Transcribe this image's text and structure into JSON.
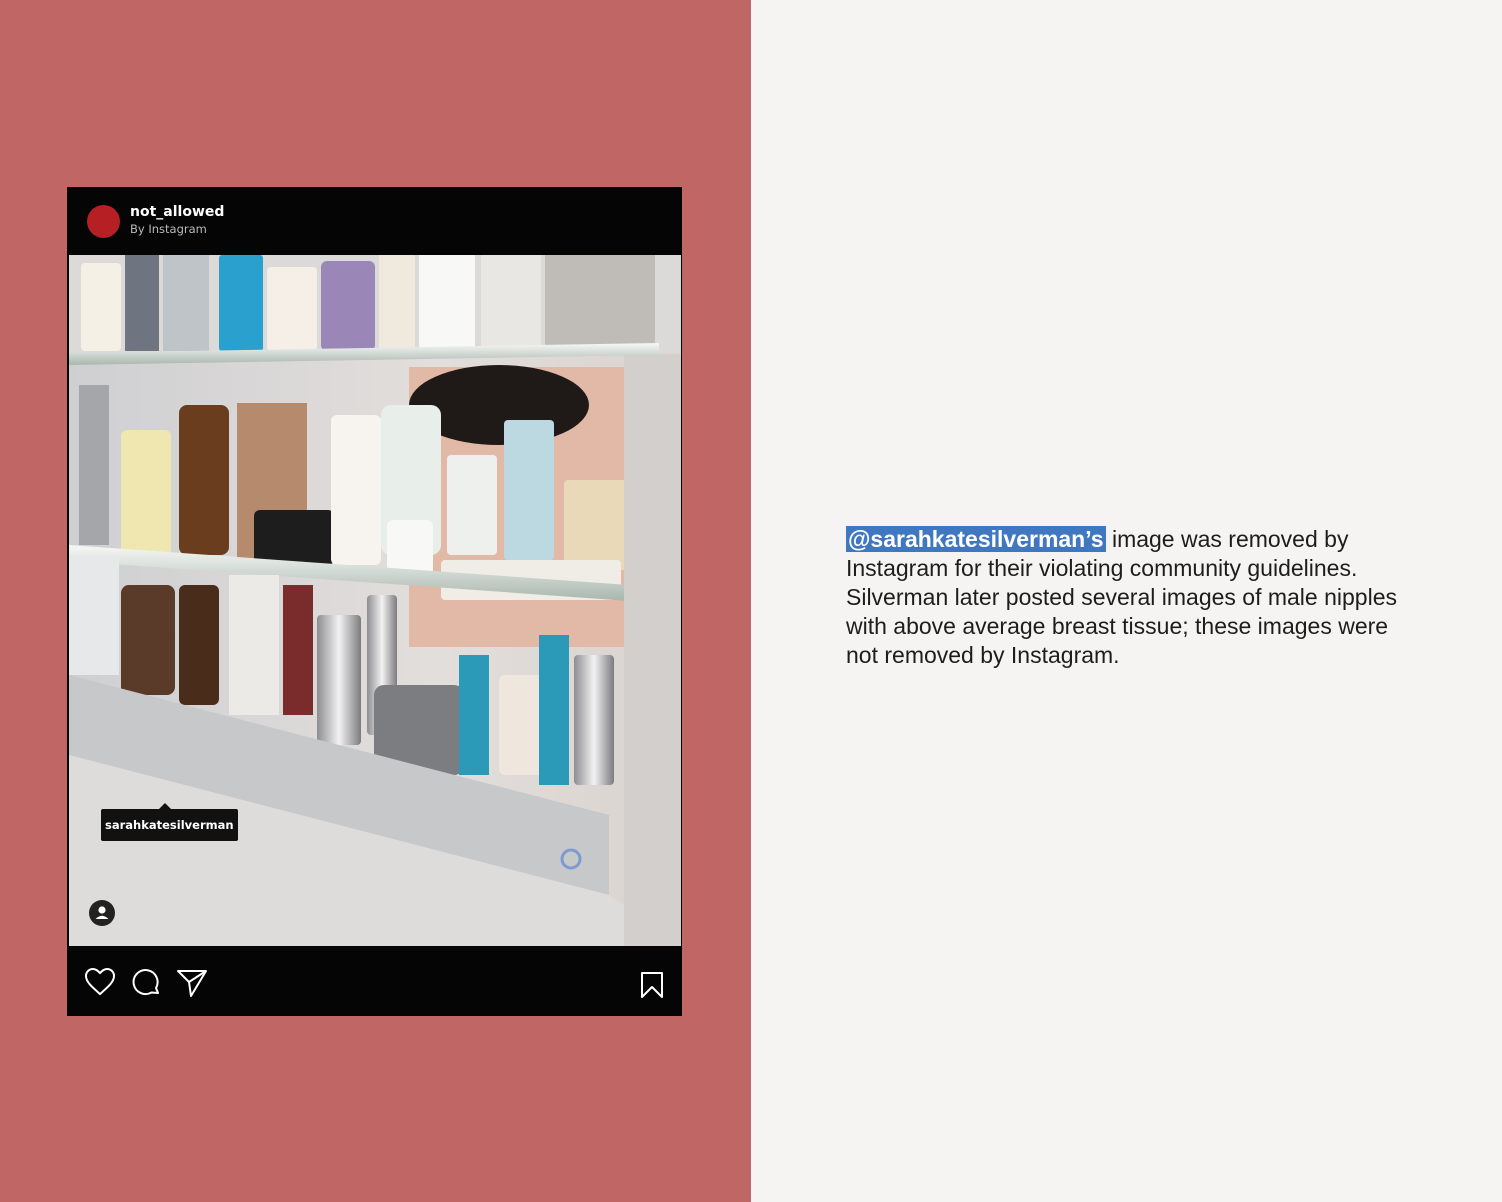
{
  "post": {
    "username": "not_allowed",
    "byline": "By Instagram",
    "tagged_user": "sarahkatesilverman"
  },
  "caption": {
    "mention": "@sarahkatesilverman’s",
    "lines": [
      "image was removed by",
      "Instagram for their violating community guidelines.",
      "Silverman later posted several images of male nipples",
      "with above average breast tissue; these images were",
      "not removed by Instagram."
    ]
  },
  "icons": {
    "like": "heart-icon",
    "comment": "comment-icon",
    "share": "send-icon",
    "save": "bookmark-icon",
    "tagged": "person-icon"
  },
  "colors": {
    "left_background": "#c06766",
    "right_background": "#f5f4f2",
    "avatar": "#b61f23",
    "mention_highlight": "#3f78c0"
  }
}
